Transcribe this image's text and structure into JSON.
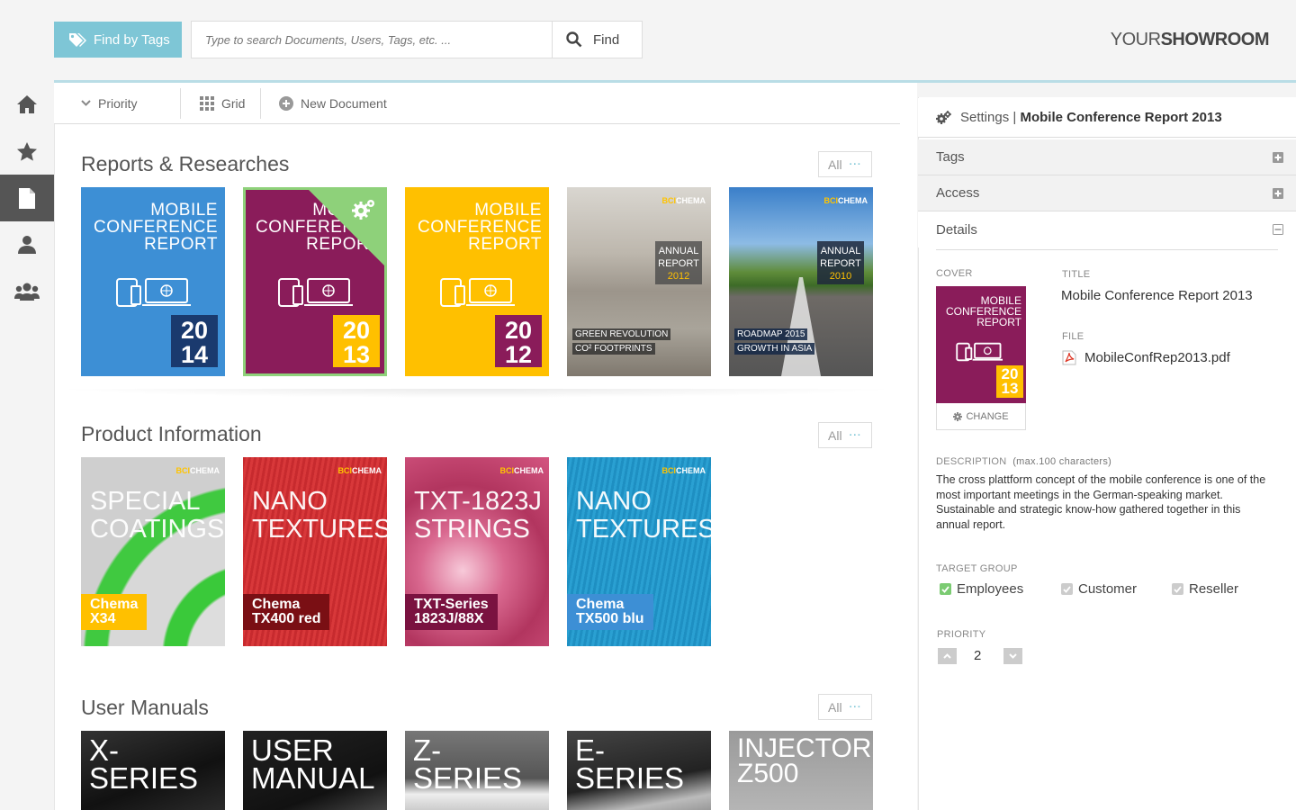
{
  "header": {
    "find_by_tags": "Find by Tags",
    "search_placeholder": "Type to search Documents, Users, Tags, etc. ...",
    "find_label": "Find",
    "logo_light": "YOUR",
    "logo_bold": "SHOWROOM"
  },
  "sidebar": {
    "items": [
      "home-icon",
      "star-icon",
      "document-icon",
      "user-icon",
      "users-icon"
    ],
    "active": "document-icon"
  },
  "toolbar": {
    "priority": "Priority",
    "grid": "Grid",
    "new_document": "New Document"
  },
  "sections": {
    "reports": {
      "title": "Reports & Researches",
      "all": "All",
      "cards": [
        {
          "title": [
            "MOBILE",
            "CONFERENCE",
            "REPORT"
          ],
          "year": [
            "20",
            "14"
          ]
        },
        {
          "title": [
            "MOBILE",
            "CONFERENCE",
            "REPORT"
          ],
          "year": [
            "20",
            "13"
          ]
        },
        {
          "title": [
            "MOBILE",
            "CONFERENCE",
            "REPORT"
          ],
          "year": [
            "20",
            "12"
          ]
        },
        {
          "brand": [
            "BCI",
            "CHEMA"
          ],
          "annual": [
            "ANNUAL",
            "REPORT",
            "2012"
          ],
          "caption": [
            "GREEN REVOLUTION",
            "CO² FOOTPRINTS"
          ]
        },
        {
          "brand": [
            "BCI",
            "CHEMA"
          ],
          "annual": [
            "ANNUAL",
            "REPORT",
            "2010"
          ],
          "caption": [
            "ROADMAP 2015",
            "GROWTH IN ASIA"
          ]
        }
      ]
    },
    "products": {
      "title": "Product Information",
      "all": "All",
      "cards": [
        {
          "title": [
            "SPECIAL",
            "COATINGS"
          ],
          "label": [
            "Chema",
            "X34"
          ],
          "brand": [
            "BCI",
            "CHEMA"
          ]
        },
        {
          "title": [
            "NANO",
            "TEXTURES"
          ],
          "label": [
            "Chema",
            "TX400 red"
          ],
          "brand": [
            "BCI",
            "CHEMA"
          ]
        },
        {
          "title": [
            "TXT-1823J",
            "STRINGS"
          ],
          "label": [
            "TXT-Series",
            "1823J/88X"
          ],
          "brand": [
            "BCI",
            "CHEMA"
          ]
        },
        {
          "title": [
            "NANO",
            "TEXTURES"
          ],
          "label": [
            "Chema",
            "TX500 blu"
          ],
          "brand": [
            "BCI",
            "CHEMA"
          ]
        }
      ]
    },
    "manuals": {
      "title": "User Manuals",
      "all": "All",
      "cards": [
        {
          "title": [
            "X-SERIES"
          ]
        },
        {
          "title": [
            "USER",
            "MANUAL"
          ]
        },
        {
          "title": [
            "Z-SERIES"
          ]
        },
        {
          "title": [
            "E-SERIES"
          ]
        },
        {
          "title": [
            "INJECTORS",
            "Z500"
          ]
        }
      ]
    }
  },
  "panel": {
    "settings_label": "Settings",
    "separator": "|",
    "doc_title": "Mobile Conference Report 2013",
    "tags": "Tags",
    "access": "Access",
    "details": "Details",
    "cover_label": "COVER",
    "cover_title": [
      "MOBILE",
      "CONFERENCE",
      "REPORT"
    ],
    "cover_year": [
      "20",
      "13"
    ],
    "change": "CHANGE",
    "title_label": "TITLE",
    "title_value": "Mobile Conference Report 2013",
    "file_label": "FILE",
    "file_value": "MobileConfRep2013.pdf",
    "description_label": "DESCRIPTION",
    "description_hint": "(max.100 characters)",
    "description": "The cross plattform concept of the mobile conference is one of the most important meetings in the German-speaking market. Sustainable and strategic know-how gathered together in this annual report.",
    "target_label": "TARGET GROUP",
    "targets": [
      {
        "label": "Employees",
        "checked": true
      },
      {
        "label": "Customer",
        "checked": false
      },
      {
        "label": "Reseller",
        "checked": false
      }
    ],
    "priority_label": "PRIORITY",
    "priority_value": "2"
  },
  "colors": {
    "accent": "#7ec6d6",
    "blue": "#3d8fd5",
    "purple": "#8a1c5a",
    "yellow": "#ffc000",
    "green": "#8ed17a"
  }
}
